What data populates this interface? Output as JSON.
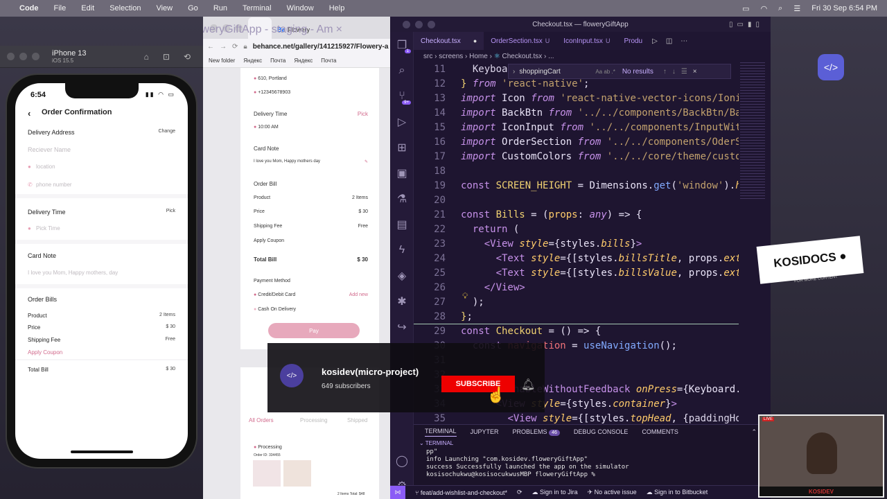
{
  "menubar": {
    "app": "Code",
    "items": [
      "File",
      "Edit",
      "Selection",
      "View",
      "Go",
      "Run",
      "Terminal",
      "Window",
      "Help"
    ],
    "clock": "Fri 30 Sep  6:54 PM"
  },
  "simulator": {
    "title": "iPhone 13",
    "subtitle": "iOS 15.5"
  },
  "phone": {
    "time": "6:54",
    "title": "Order Confirmation",
    "delivery_address": "Delivery Address",
    "change": "Change",
    "receiver_ph": "Reciever Name",
    "location_ph": "location",
    "phone_ph": "phone number",
    "delivery_time": "Delivery Time",
    "pick": "Pick",
    "pick_time_ph": "Pick Time",
    "card_note": "Card Note",
    "card_note_ph": "I love you Mom, Happy mothers, day",
    "order_bills": "Order Bills",
    "product": "Product",
    "product_v": "2 Items",
    "price": "Price",
    "price_v": "$ 30",
    "shipping": "Shipping Fee",
    "shipping_v": "Free",
    "coupon": "Apply Coupon",
    "total": "Total Bill",
    "total_v": "$ 30"
  },
  "browser": {
    "tab1": "floweryGiftApp - staging - Am",
    "tab2": "Flowery",
    "url": "behance.net/gallery/141215927/Flowery-a",
    "bookmarks": [
      "New folder",
      "Яндекс",
      "Почта",
      "Яндекс",
      "Почта"
    ],
    "card": {
      "addr": "610, Portland",
      "phone": "+12345678903",
      "delivery_time": "Delivery Time",
      "pick": "Pick",
      "time": "10:00 AM",
      "card_note": "Card Note",
      "note": "I love you Mom, Happy mothers day",
      "order_bill": "Order Bill",
      "product": "Product",
      "product_v": "2 Items",
      "price": "Price",
      "price_v": "$ 30",
      "shipping": "Shipping Fee",
      "shipping_v": "Free",
      "coupon": "Apply Coupon",
      "total": "Total Bill",
      "total_v": "$ 30",
      "payment": "Payment Method",
      "card": "Credit/Debit Card",
      "add_new": "Add new",
      "cod": "Cash On Delivery",
      "pay": "Pay"
    },
    "orders": {
      "all": "All Orders",
      "processing": "Processing",
      "shipped": "Shipped",
      "status": "Processing",
      "order_id": "Order ID: 334455",
      "items": "2 Items",
      "total": "Total: $48"
    }
  },
  "vscode": {
    "title": "Checkout.tsx — floweryGiftApp",
    "tabs": [
      {
        "name": "Checkout.tsx",
        "mark": "●"
      },
      {
        "name": "OrderSection.tsx",
        "mark": "U"
      },
      {
        "name": "IconInput.tsx",
        "mark": "U"
      },
      {
        "name": "Produ",
        "mark": ""
      }
    ],
    "breadcrumb": [
      "src",
      "screens",
      "Home",
      "Checkout.tsx",
      "..."
    ],
    "find": {
      "query": "shoppingCart",
      "result": "No results"
    },
    "panel_tabs": [
      "TERMINAL",
      "JUPYTER",
      "PROBLEMS",
      "DEBUG CONSOLE",
      "COMMENTS"
    ],
    "problems_count": "46",
    "terminal_label": "TERMINAL",
    "terminal": [
      "pp\"",
      "info Launching \"com.kosidev.floweryGiftApp\"",
      "success Successfully launched the app on the simulator",
      "kosisochukwu@kosisocukwusMBP floweryGiftApp % "
    ],
    "status": {
      "branch": "feat/add-wishlist-and-checkout*",
      "jira": "Sign in to Jira",
      "issue": "No active issue",
      "bitbucket": "Sign in to Bitbucket"
    }
  },
  "youtube": {
    "channel": "kosidev(micro-project)",
    "subs": "649 subscribers",
    "subscribe": "SUBSCRIBE"
  },
  "brand": {
    "name": "KOSIDOCS",
    "tagline": "FOR MORE CONTENT",
    "cam_label": "KOSIDEV",
    "live": "LIVE"
  }
}
